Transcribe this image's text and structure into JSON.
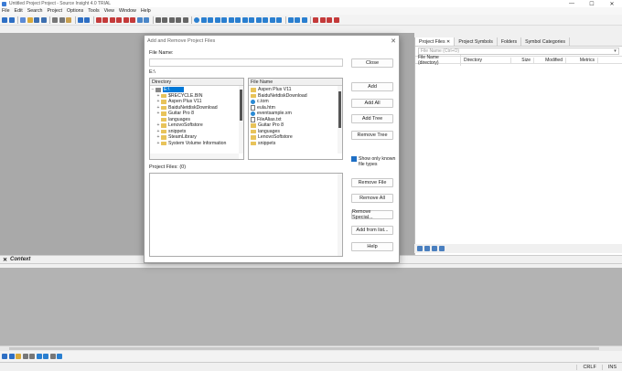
{
  "window": {
    "title": "Untitled Project Project - Source Insight 4.0 TRIAL",
    "controls": [
      "—",
      "☐",
      "✕"
    ]
  },
  "menu": [
    "File",
    "Edit",
    "Search",
    "Project",
    "Options",
    "Tools",
    "View",
    "Window",
    "Help"
  ],
  "right_panel": {
    "tabs": [
      "Project Files ✕",
      "Project Symbols",
      "Folders",
      "Symbol Categories"
    ],
    "search_placeholder": "File Name (Ctrl+O)",
    "columns": [
      "File Name (directory)",
      "Directory",
      "Size",
      "Modified",
      "Metrics"
    ]
  },
  "context": {
    "label": "Context"
  },
  "status": {
    "line_ending": "CRLF",
    "encoding": "INS"
  },
  "dialog": {
    "title": "Add and Remove Project Files",
    "file_name_label": "File Name:",
    "file_name_value": "",
    "current_path": "E:\\",
    "directory_header": "Directory",
    "directory_items": [
      {
        "label": "E:\\",
        "selected": true,
        "expand": "−"
      },
      {
        "label": "$RECYCLE.BIN",
        "expand": "+"
      },
      {
        "label": "Aspen Plus V11",
        "expand": "+"
      },
      {
        "label": "BaiduNetdiskDownload",
        "expand": "+"
      },
      {
        "label": "Guitar Pro 8",
        "expand": "+"
      },
      {
        "label": "languages",
        "expand": ""
      },
      {
        "label": "LenovoSoftstore",
        "expand": "+"
      },
      {
        "label": "snippets",
        "expand": "+"
      },
      {
        "label": "SteamLibrary",
        "expand": "+"
      },
      {
        "label": "System Volume Information",
        "expand": "+"
      }
    ],
    "filename_header": "File Name",
    "file_items": [
      {
        "label": "Aspen Plus V11",
        "icon": "folder"
      },
      {
        "label": "BaiduNetdiskDownload",
        "icon": "folder"
      },
      {
        "label": "c.tom",
        "icon": "web"
      },
      {
        "label": "eula.htm",
        "icon": "file"
      },
      {
        "label": "eventsample.xm",
        "icon": "web"
      },
      {
        "label": "FileAlias.txt",
        "icon": "file"
      },
      {
        "label": "Guitar Pro 8",
        "icon": "folder"
      },
      {
        "label": "languages",
        "icon": "folder"
      },
      {
        "label": "LenovoSoftstore",
        "icon": "folder"
      },
      {
        "label": "snippets",
        "icon": "folder"
      }
    ],
    "buttons_top": [
      "Close",
      "Add",
      "Add All",
      "Add Tree",
      "Remove Tree"
    ],
    "show_known_label": "Show only known",
    "show_known_label2": "file types",
    "project_files_label": "Project Files: (0)",
    "buttons_bottom": [
      "Remove File",
      "Remove All",
      "Remove Special...",
      "Add from list...",
      "Help"
    ]
  }
}
